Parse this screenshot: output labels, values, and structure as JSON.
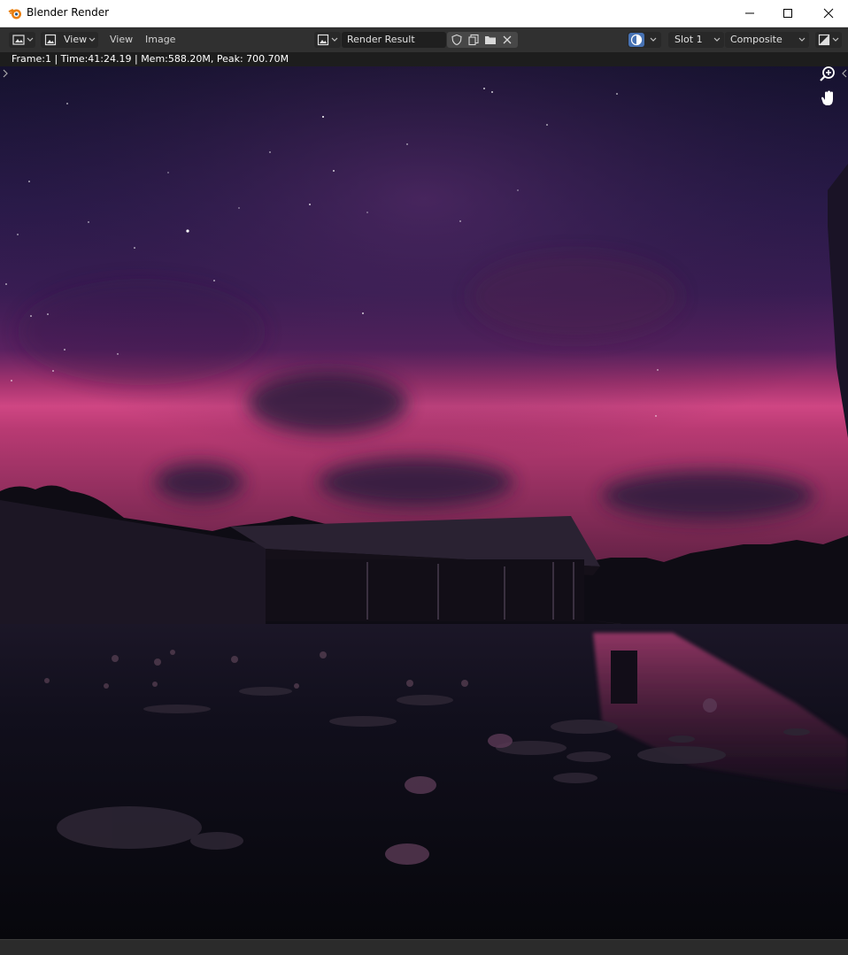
{
  "window": {
    "title": "Blender Render",
    "app_icon": "blender-logo-icon",
    "controls": [
      "minimize-icon",
      "maximize-icon",
      "close-icon"
    ]
  },
  "header": {
    "editor_type_icon": "image-editor-icon",
    "mode_icon": "image-icon",
    "mode_label": "View",
    "menus": [
      "View",
      "Image"
    ],
    "image_browse_icon": "image-browse-icon",
    "image_name": "Render Result",
    "image_actions": [
      "fake-user-shield-icon",
      "duplicate-icon",
      "open-folder-icon",
      "close-icon"
    ],
    "display_channel_icon": "display-channels-icon",
    "slot": "Slot 1",
    "layer": "Composite",
    "gizmo_icon": "overlay-gizmo-icon"
  },
  "info": {
    "text": "Frame:1 | Time:41:24.19 | Mem:588.20M, Peak: 700.70M"
  },
  "viewport": {
    "navigation": [
      "zoom-icon",
      "pan-hand-icon"
    ]
  },
  "colors": {
    "title_bar": "#ffffff",
    "header_bg": "#303030",
    "field_bg": "#282828",
    "accent_blue": "#4772b3",
    "sky_top": "#1a1636",
    "sky_horizon": "#d64a86"
  }
}
